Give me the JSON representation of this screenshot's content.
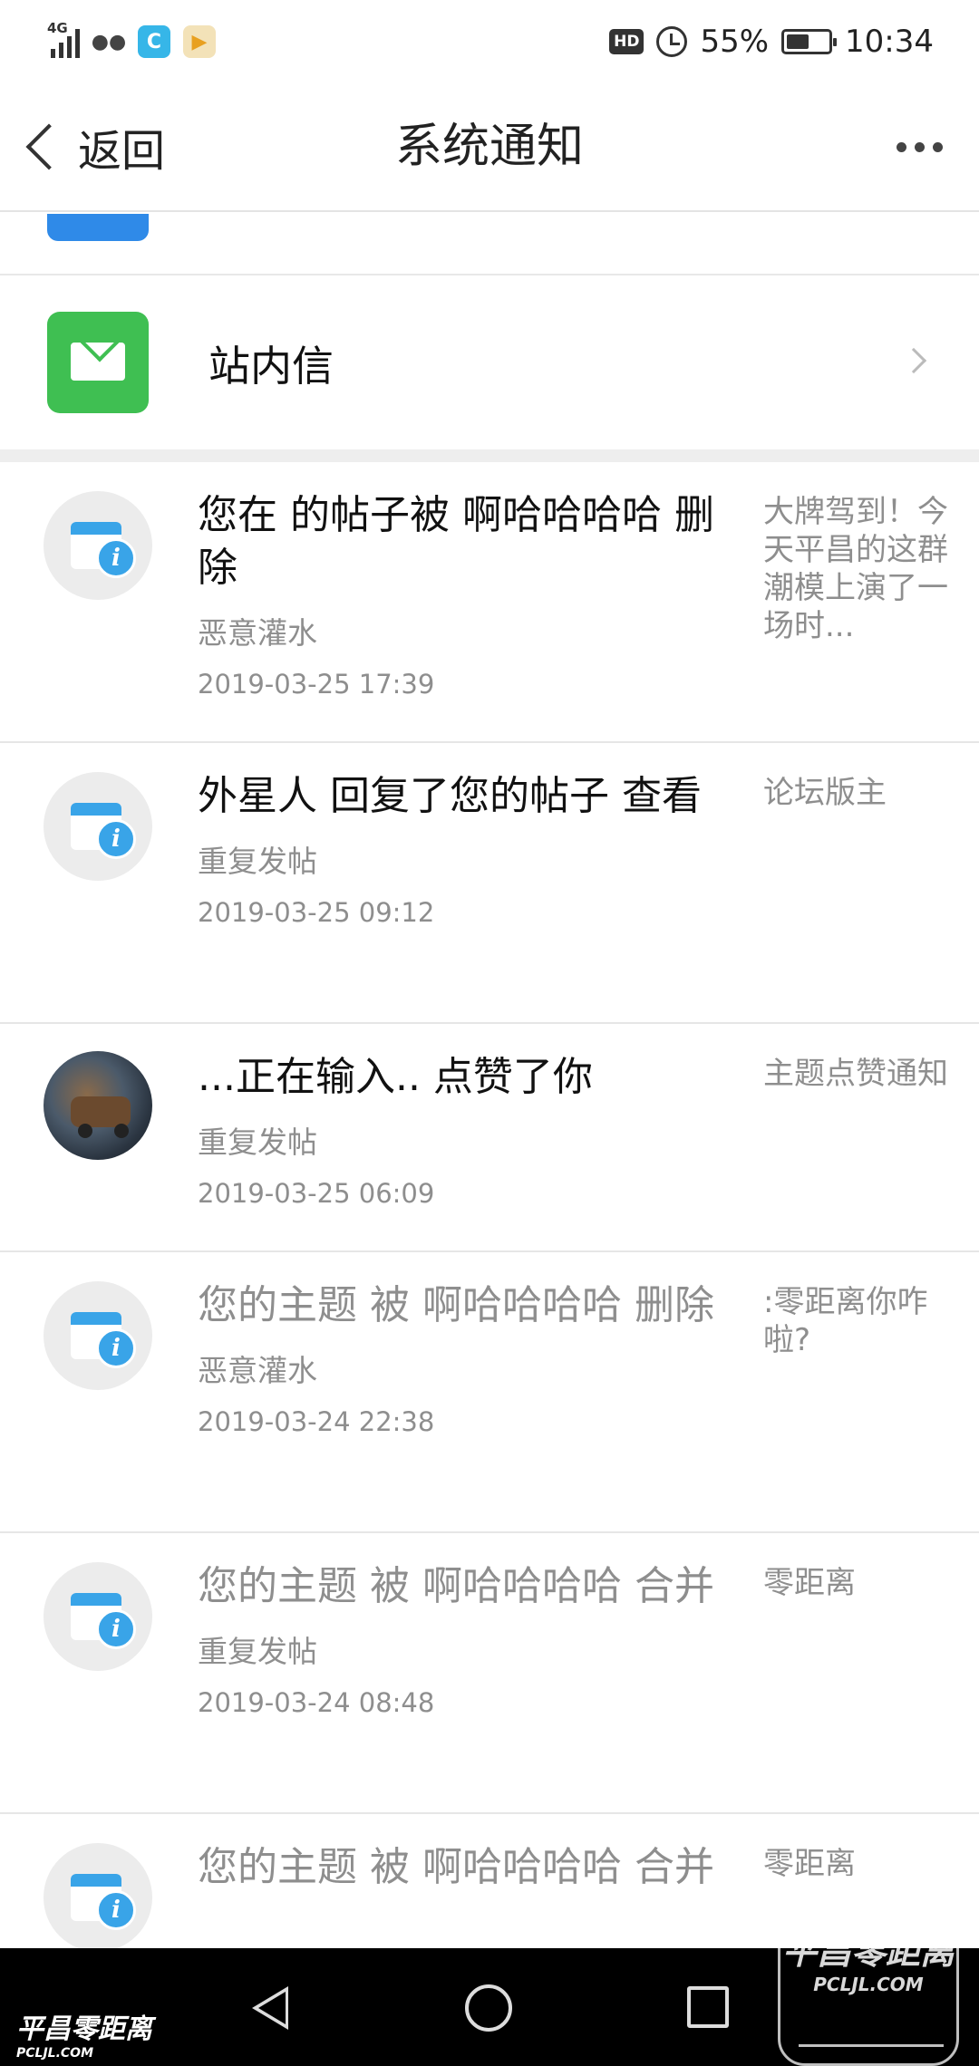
{
  "status_bar": {
    "network": "4G",
    "battery": "55%",
    "time": "10:34",
    "hd": "HD",
    "app_icons": [
      "wechat-icon",
      "browser-icon",
      "video-icon"
    ]
  },
  "header": {
    "back_label": "返回",
    "title": "系统通知"
  },
  "mail_entry": {
    "label": "站内信"
  },
  "notifications": [
    {
      "avatar": "info",
      "message": "您在 的帖子被 啊哈哈哈哈 删除",
      "tag": "恶意灌水",
      "time": "2019-03-25 17:39",
      "preview": "大牌驾到！今天平昌的这群潮模上演了一场时...",
      "read": false
    },
    {
      "avatar": "info",
      "message": "外星人 回复了您的帖子   查看",
      "tag": "重复发帖",
      "time": "2019-03-25 09:12",
      "preview": "论坛版主",
      "read": false
    },
    {
      "avatar": "photo",
      "message": "...正在输入.. 点赞了你",
      "tag": "重复发帖",
      "time": "2019-03-25 06:09",
      "preview": "主题点赞通知",
      "read": false
    },
    {
      "avatar": "info",
      "message": "您的主题 被 啊哈哈哈哈 删除",
      "tag": "恶意灌水",
      "time": "2019-03-24 22:38",
      "preview": ":零距离你咋啦?",
      "read": true
    },
    {
      "avatar": "info",
      "message": "您的主题 被 啊哈哈哈哈 合并",
      "tag": "重复发帖",
      "time": "2019-03-24 08:48",
      "preview": "零距离",
      "read": true
    },
    {
      "avatar": "info",
      "message": "您的主题 被 啊哈哈哈哈 合并",
      "tag": "",
      "time": "",
      "preview": "零距离",
      "read": true
    }
  ],
  "watermark": {
    "name": "平昌零距离",
    "url": "PCLJL.COM"
  },
  "colors": {
    "mail_green": "#3fbf52",
    "info_blue": "#39a4e8",
    "partial_blue": "#2f8ae8"
  }
}
